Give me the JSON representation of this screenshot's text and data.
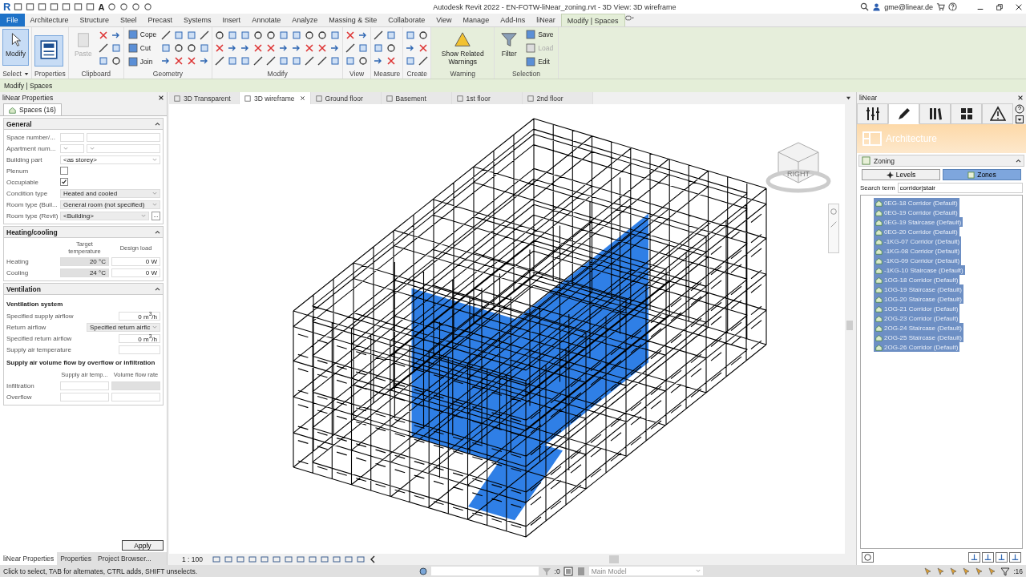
{
  "title_bar": {
    "logo": "R",
    "text_tool": "A",
    "title": "Autodesk Revit 2022 - EN-FOTW-liNear_zoning.rvt - 3D View: 3D wireframe",
    "user": "gme@linear.de"
  },
  "menu_tabs": [
    {
      "label": "File",
      "kind": "file",
      "selected": false
    },
    {
      "label": "Architecture",
      "kind": "tab",
      "selected": false
    },
    {
      "label": "Structure",
      "kind": "tab",
      "selected": false
    },
    {
      "label": "Steel",
      "kind": "tab",
      "selected": false
    },
    {
      "label": "Precast",
      "kind": "tab",
      "selected": false
    },
    {
      "label": "Systems",
      "kind": "tab",
      "selected": false
    },
    {
      "label": "Insert",
      "kind": "tab",
      "selected": false
    },
    {
      "label": "Annotate",
      "kind": "tab",
      "selected": false
    },
    {
      "label": "Analyze",
      "kind": "tab",
      "selected": false
    },
    {
      "label": "Massing & Site",
      "kind": "tab",
      "selected": false
    },
    {
      "label": "Collaborate",
      "kind": "tab",
      "selected": false
    },
    {
      "label": "View",
      "kind": "tab",
      "selected": false
    },
    {
      "label": "Manage",
      "kind": "tab",
      "selected": false
    },
    {
      "label": "Add-Ins",
      "kind": "tab",
      "selected": false
    },
    {
      "label": "liNear",
      "kind": "tab",
      "selected": false
    },
    {
      "label": "Modify | Spaces",
      "kind": "tab",
      "selected": true
    }
  ],
  "ribbon": {
    "groups": [
      {
        "label": "Select",
        "dropdown": true,
        "tools": [
          {
            "kind": "large",
            "label": "Modify",
            "selected": true
          }
        ]
      },
      {
        "label": "Properties",
        "tools": [
          {
            "kind": "icon",
            "selected": true
          }
        ]
      },
      {
        "label": "Clipboard",
        "tools": [
          {
            "kind": "large",
            "label": "Paste",
            "disabled": true
          },
          {
            "kind": "grid"
          }
        ]
      },
      {
        "label": "Geometry",
        "tools": [
          {
            "kind": "small",
            "items": [
              {
                "label": "Cope",
                "disabled": false
              },
              {
                "label": "Cut",
                "disabled": false
              },
              {
                "label": "Join",
                "disabled": false
              }
            ]
          },
          {
            "kind": "grid"
          },
          {
            "kind": "grid"
          }
        ]
      },
      {
        "label": "Modify",
        "tools": [
          {
            "kind": "grid"
          },
          {
            "kind": "grid"
          },
          {
            "kind": "grid"
          },
          {
            "kind": "grid"
          },
          {
            "kind": "grid"
          }
        ]
      },
      {
        "label": "View",
        "tools": [
          {
            "kind": "grid"
          }
        ]
      },
      {
        "label": "Measure",
        "tools": [
          {
            "kind": "grid"
          }
        ]
      },
      {
        "label": "Create",
        "tools": [
          {
            "kind": "grid"
          }
        ]
      },
      {
        "label": "Warning",
        "tools": [
          {
            "kind": "large",
            "label": "Show Related Warnings"
          }
        ]
      },
      {
        "label": "Selection",
        "tools": [
          {
            "kind": "large",
            "label": "Filter"
          },
          {
            "kind": "small",
            "items": [
              {
                "label": "Save",
                "disabled": false
              },
              {
                "label": "Load",
                "disabled": true
              },
              {
                "label": "Edit",
                "disabled": false
              }
            ]
          }
        ]
      }
    ]
  },
  "context_bar": "Modify | Spaces",
  "properties_panel": {
    "title": "liNear Properties",
    "tab": "Spaces (16)",
    "sections": [
      {
        "title": "General",
        "expanded": true,
        "rows": [
          {
            "kind": "two_fields",
            "label": "Space number/..."
          },
          {
            "kind": "two_selects",
            "label": "Apartment num..."
          },
          {
            "kind": "select",
            "label": "Building part",
            "value": "<as storey>"
          },
          {
            "kind": "checkbox",
            "label": "Plenum",
            "checked": false
          },
          {
            "kind": "checkbox",
            "label": "Occupiable",
            "checked": true
          },
          {
            "kind": "combo",
            "label": "Condition type",
            "value": "Heated and cooled"
          },
          {
            "kind": "combo",
            "label": "Room type (Buil...",
            "value": "General room (not specified)"
          },
          {
            "kind": "combo_button",
            "label": "Room type (Revit)",
            "value": "<Building>",
            "button": "..."
          }
        ]
      },
      {
        "title": "Heating/cooling",
        "expanded": true,
        "rows": [
          {
            "kind": "headers",
            "cells": [
              "Target temperature",
              "Design load"
            ]
          },
          {
            "kind": "values",
            "label": "Heating",
            "cells": [
              {
                "value": "20 °C",
                "readonly": true
              },
              {
                "value": "0 W",
                "readonly": false
              }
            ]
          },
          {
            "kind": "values",
            "label": "Cooling",
            "cells": [
              {
                "value": "24 °C",
                "readonly": true
              },
              {
                "value": "0 W",
                "readonly": false
              }
            ]
          }
        ]
      },
      {
        "title": "Ventilation",
        "expanded": true,
        "rows": [
          {
            "kind": "subtitle",
            "text": "Ventilation system"
          },
          {
            "kind": "value",
            "label": "Specified supply airflow",
            "value": "0 m$^{3}$/h"
          },
          {
            "kind": "wide_select",
            "label": "Return airflow",
            "value": "Specified return airflc"
          },
          {
            "kind": "value",
            "label": "Specified return airflow",
            "value": "0 m$^{3}$/h"
          },
          {
            "kind": "value",
            "label": "Supply air temperature"
          },
          {
            "kind": "subtitle",
            "text": "Supply air volume flow by overflow or infiltration"
          },
          {
            "kind": "headers",
            "cells": [
              "Supply air temp...",
              "Volume flow rate"
            ]
          },
          {
            "kind": "values",
            "label": "Infiltration",
            "cells": [
              {
                "readonly": false
              },
              {
                "readonly": true
              }
            ]
          },
          {
            "kind": "values",
            "label": "Overflow",
            "cells": [
              {
                "readonly": false
              },
              {
                "readonly": false
              }
            ]
          }
        ]
      }
    ],
    "apply_button": "Apply"
  },
  "panel_tabs": [
    {
      "label": "liNear Properties",
      "selected": true
    },
    {
      "label": "Properties",
      "selected": false
    },
    {
      "label": "Project Browser...",
      "selected": false
    }
  ],
  "view_tabs": [
    {
      "label": "3D Transparent",
      "selected": false
    },
    {
      "label": "3D wireframe",
      "selected": true
    },
    {
      "label": "Ground floor",
      "selected": false
    },
    {
      "label": "Basement",
      "selected": false
    },
    {
      "label": "1st floor",
      "selected": false
    },
    {
      "label": "2nd floor",
      "selected": false
    }
  ],
  "view_cube": {
    "label": "RIGHT"
  },
  "view_control_bar": {
    "scale": "1 : 100"
  },
  "linear_panel": {
    "title": "liNear",
    "tabs": [
      {
        "selected": false
      },
      {
        "selected": true
      },
      {
        "selected": false
      },
      {
        "selected": false
      },
      {
        "selected": false
      }
    ],
    "banner": "Architecture",
    "section": "Zoning",
    "toggles": [
      {
        "label": "Levels",
        "selected": false
      },
      {
        "label": "Zones",
        "selected": true
      }
    ],
    "search": {
      "label": "Search term",
      "value": "corridor|stair"
    },
    "items": [
      {
        "text": "0EG-18 Corridor (Default)",
        "selected": true
      },
      {
        "text": "0EG-19 Corridor (Default)",
        "selected": true
      },
      {
        "text": "0EG-19 Staircase (Default)",
        "selected": true
      },
      {
        "text": "0EG-20 Corridor (Default)",
        "selected": true
      },
      {
        "text": "-1KG-07 Corridor (Default)",
        "selected": true
      },
      {
        "text": "-1KG-08 Corridor (Default)",
        "selected": true
      },
      {
        "text": "-1KG-09 Corridor (Default)",
        "selected": true
      },
      {
        "text": "-1KG-10 Staircase (Default)",
        "selected": true
      },
      {
        "text": "1OG-18 Corridor (Default)",
        "selected": true
      },
      {
        "text": "1OG-19 Staircase (Default)",
        "selected": true
      },
      {
        "text": "1OG-20 Staircase (Default)",
        "selected": true
      },
      {
        "text": "1OG-21 Corridor (Default)",
        "selected": true
      },
      {
        "text": "2OG-23 Corridor (Default)",
        "selected": true
      },
      {
        "text": "2OG-24 Staircase (Default)",
        "selected": true
      },
      {
        "text": "2OG-25 Staircase (Default)",
        "selected": true
      },
      {
        "text": "2OG-26 Corridor (Default)",
        "selected": true
      }
    ]
  },
  "status_bar": {
    "message": "Click to select, TAB for alternates, CTRL adds, SHIFT unselects.",
    "workset_count": ":0",
    "model": "Main Model",
    "filter_count": ":16"
  }
}
